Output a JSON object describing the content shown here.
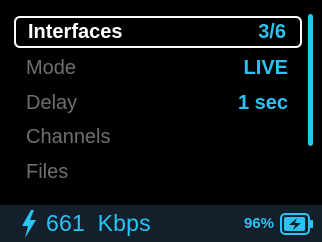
{
  "menu": {
    "items": [
      {
        "label": "Interfaces",
        "value": "3/6",
        "selected": true
      },
      {
        "label": "Mode",
        "value": "LIVE",
        "selected": false
      },
      {
        "label": "Delay",
        "value": "1 sec",
        "selected": false
      },
      {
        "label": "Channels",
        "value": "",
        "selected": false
      },
      {
        "label": "Files",
        "value": "",
        "selected": false
      }
    ]
  },
  "status": {
    "bitrate_value": "661",
    "bitrate_unit": "Kbps",
    "battery_percent": "96%",
    "battery_level": 0.96,
    "charging": true,
    "icons": {
      "bitrate": "lightning-bolt-icon",
      "battery": "battery-charging-icon"
    }
  },
  "colors": {
    "accent": "#2bc3f2",
    "text_selected": "#ffffff",
    "text_dim": "#6f6f6f",
    "status_bg": "#13202b",
    "background": "#000000"
  }
}
